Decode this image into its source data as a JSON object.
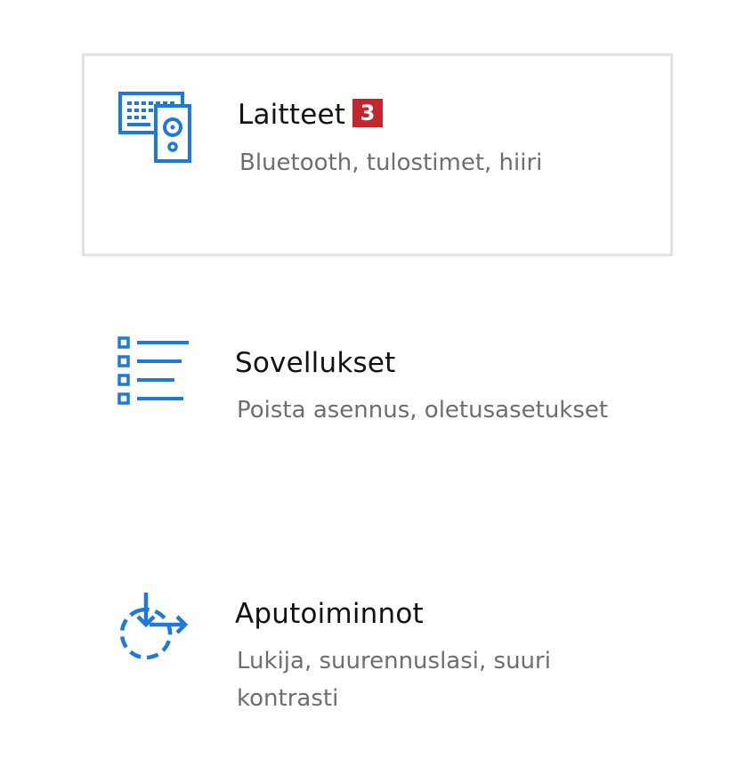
{
  "accent_color": "#1e7ad6",
  "badge_color": "#c1272d",
  "tiles": [
    {
      "title": "Laitteet",
      "subtitle": "Bluetooth, tulostimet, hiiri",
      "icon": "devices-icon",
      "badge": "3",
      "selected": true
    },
    {
      "title": "Sovellukset",
      "subtitle": "Poista asennus, oletusasetukset",
      "icon": "apps-list-icon",
      "selected": false
    },
    {
      "title": "Aputoiminnot",
      "subtitle": "Lukija, suurennuslasi, suuri kontrasti",
      "icon": "ease-of-access-icon",
      "selected": false
    }
  ]
}
